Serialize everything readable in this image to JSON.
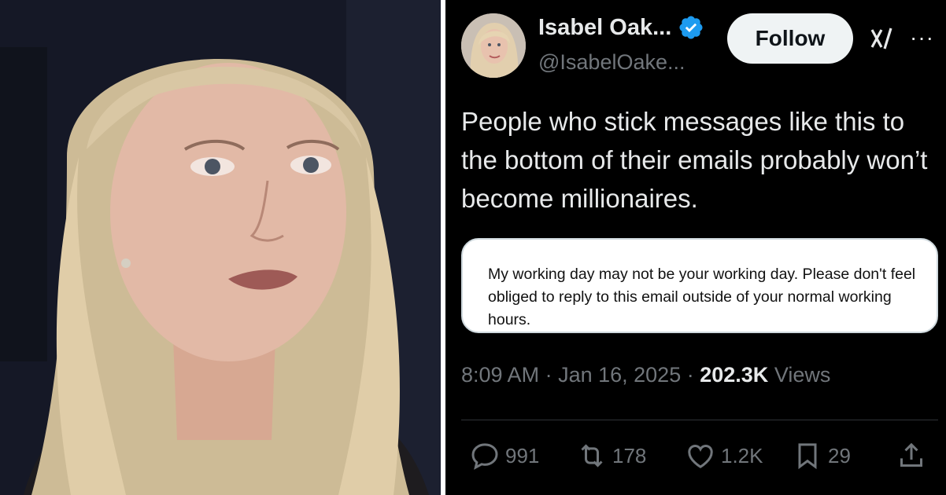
{
  "photo": {
    "alt": ""
  },
  "tweet": {
    "display_name": "Isabel Oak...",
    "handle": "@IsabelOake...",
    "follow_label": "Follow",
    "more_label": "···",
    "text": "People who stick messages like this to the bottom of their emails probably won’t become millionaires.",
    "card_text": "My working day may not be your working day.  Please don't feel obliged to reply to this email outside of your normal working hours.",
    "time": "8:09 AM",
    "date": "Jan 16, 2025",
    "views_count": "202.3K",
    "views_label": "Views",
    "replies": "991",
    "reposts": "178",
    "likes": "1.2K",
    "bookmarks": "29"
  },
  "icons": [
    "verified-badge-icon",
    "grok-icon",
    "more-icon",
    "reply-icon",
    "repost-icon",
    "like-icon",
    "bookmark-icon",
    "share-icon"
  ],
  "colors": {
    "background": "#000000",
    "text": "#e7e9ea",
    "muted": "#71767b",
    "verified": "#1d9bf0",
    "follow_bg": "#eff3f4"
  }
}
